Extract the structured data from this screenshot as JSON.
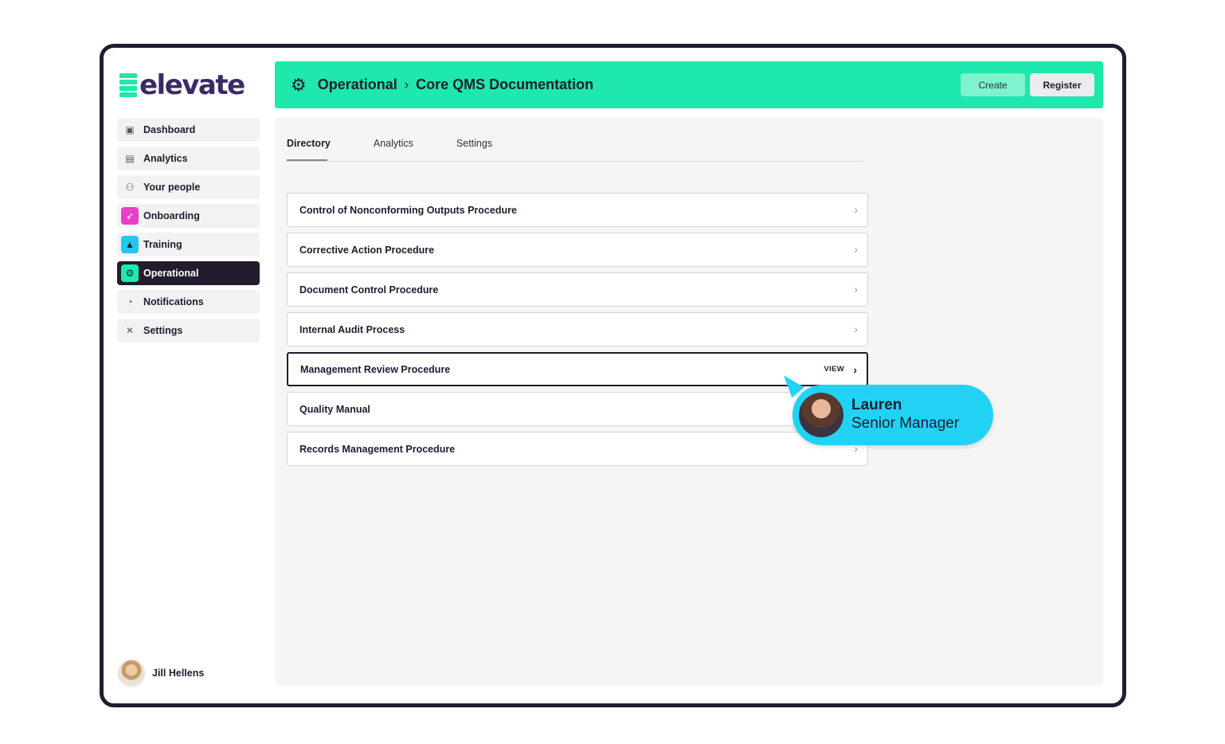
{
  "brand": {
    "name": "elevate",
    "accent": "#1ee8ab",
    "dark": "#231c2f"
  },
  "sidebar": {
    "items": [
      {
        "label": "Dashboard",
        "icon": "dashboard-icon"
      },
      {
        "label": "Analytics",
        "icon": "analytics-icon"
      },
      {
        "label": "Your people",
        "icon": "people-icon"
      },
      {
        "label": "Onboarding",
        "icon": "rocket-icon"
      },
      {
        "label": "Training",
        "icon": "graduation-cap-icon"
      },
      {
        "label": "Operational",
        "icon": "gears-icon"
      },
      {
        "label": "Notifications",
        "icon": "bell-icon"
      },
      {
        "label": "Settings",
        "icon": "tools-icon"
      }
    ],
    "active": "Operational"
  },
  "user": {
    "name": "Jill Hellens"
  },
  "header": {
    "section": "Operational",
    "page": "Core QMS Documentation",
    "create_label": "Create",
    "register_label": "Register"
  },
  "tabs": [
    {
      "label": "Directory"
    },
    {
      "label": "Analytics"
    },
    {
      "label": "Settings"
    }
  ],
  "documents": [
    {
      "title": "Control of Nonconforming Outputs Procedure"
    },
    {
      "title": "Corrective Action Procedure"
    },
    {
      "title": "Document Control Procedure"
    },
    {
      "title": "Internal Audit Process"
    },
    {
      "title": "Management Review Procedure",
      "action": "VIEW"
    },
    {
      "title": "Quality Manual"
    },
    {
      "title": "Records Management Procedure"
    }
  ],
  "tooltip": {
    "name": "Lauren",
    "role": "Senior Manager"
  }
}
